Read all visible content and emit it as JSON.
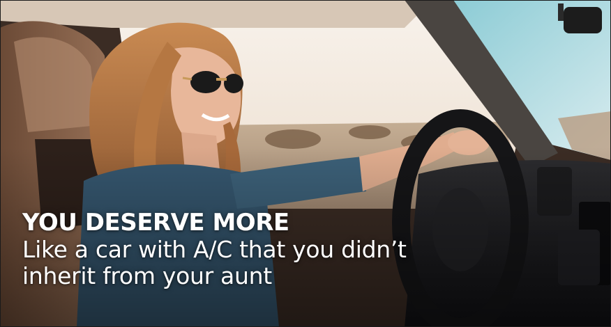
{
  "ad": {
    "headline": "YOU DESERVE MORE",
    "subline": "Like a car with A/C that you didn’t inherit from your aunt"
  },
  "photo": {
    "subject": "woman-driving-car-icon"
  }
}
